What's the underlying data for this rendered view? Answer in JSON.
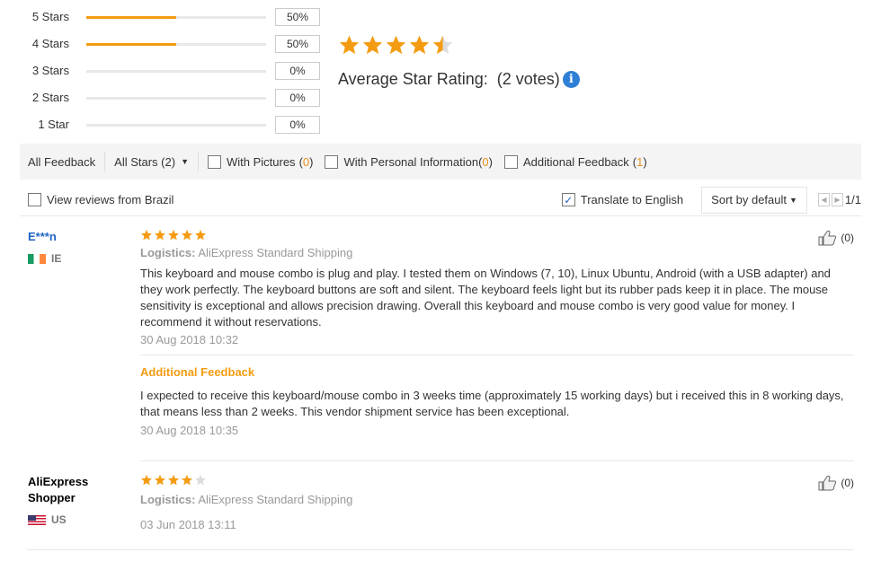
{
  "breakdown": [
    {
      "label": "5 Stars",
      "percent": 50,
      "pct_text": "50%"
    },
    {
      "label": "4 Stars",
      "percent": 50,
      "pct_text": "50%"
    },
    {
      "label": "3 Stars",
      "percent": 0,
      "pct_text": "0%"
    },
    {
      "label": "2 Stars",
      "percent": 0,
      "pct_text": "0%"
    },
    {
      "label": "1 Star",
      "percent": 0,
      "pct_text": "0%"
    }
  ],
  "average": {
    "rating": 4.5,
    "label": "Average Star Rating:",
    "votes": "(2 votes)",
    "info_icon": "info-icon",
    "info_glyph": "i"
  },
  "filters": {
    "all_feedback": "All Feedback",
    "all_stars": "All Stars (2)",
    "with_pictures": "With Pictures",
    "with_pictures_count": "0",
    "with_personal": "With Personal Information",
    "with_personal_count": "0",
    "additional": "Additional Feedback",
    "additional_count": "1",
    "open_paren": "(",
    "close_paren": ")"
  },
  "row2": {
    "view_brazil": "View reviews from Brazil",
    "translate": "Translate to English",
    "translate_checked": true,
    "sort": "Sort by default",
    "page": "1/1"
  },
  "reviews": [
    {
      "name": "E***n",
      "country": "IE",
      "stars": 5,
      "logistics_label": "Logistics:",
      "logistics": "AliExpress Standard Shipping",
      "text": "This keyboard and mouse combo is plug and play. I tested them on Windows (7, 10), Linux Ubuntu, Android (with a USB adapter) and they work perfectly. The keyboard buttons are soft and silent. The keyboard feels light but its rubber pads keep it in place. The mouse sensitivity is exceptional and allows precision drawing. Overall this keyboard and mouse combo is very good value for money. I recommend it without reservations.",
      "date": "30 Aug 2018 10:32",
      "additional_label": "Additional Feedback",
      "additional_text": "I expected to receive this keyboard/mouse combo in 3 weeks time (approximately 15 working days) but i received this in 8 working days, that means less than 2 weeks. This vendor shipment service has been exceptional.",
      "additional_date": "30 Aug 2018 10:35",
      "helpful": "(0)"
    },
    {
      "name": "AliExpress Shopper",
      "country": "US",
      "stars": 4,
      "logistics_label": "Logistics:",
      "logistics": "AliExpress Standard Shipping",
      "date": "03 Jun 2018 13:11",
      "helpful": "(0)"
    }
  ],
  "colors": {
    "star": "#f39c12",
    "star_empty": "#dddddd",
    "link": "#2064c5",
    "accent": "#e8921a"
  }
}
